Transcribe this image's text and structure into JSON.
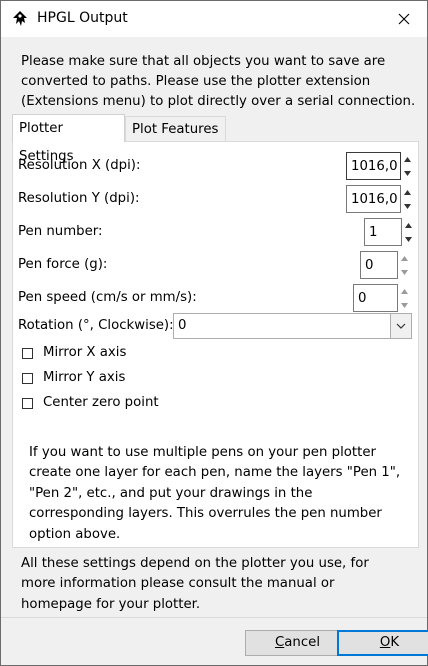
{
  "window": {
    "title": "HPGL Output"
  },
  "intro_text": "Please make sure that all objects you want to save are converted to paths. Please use the plotter extension (Extensions menu) to plot directly over a serial connection.",
  "tabs": [
    {
      "label": "Plotter Settings",
      "active": true
    },
    {
      "label": "Plot Features",
      "active": false
    }
  ],
  "settings": {
    "resolution_x": {
      "label": "Resolution X (dpi):",
      "value": "1016,0"
    },
    "resolution_y": {
      "label": "Resolution Y (dpi):",
      "value": "1016,0"
    },
    "pen_number": {
      "label": "Pen number:",
      "value": "1"
    },
    "pen_force": {
      "label": "Pen force (g):",
      "value": "0"
    },
    "pen_speed": {
      "label": "Pen speed (cm/s or mm/s):",
      "value": "0"
    },
    "rotation": {
      "label": "Rotation (°, Clockwise):",
      "value": "0"
    }
  },
  "checkboxes": {
    "mirror_x": {
      "label": "Mirror X axis",
      "checked": false
    },
    "mirror_y": {
      "label": "Mirror Y axis",
      "checked": false
    },
    "center_zero": {
      "label": "Center zero point",
      "checked": false
    }
  },
  "pen_note": "If you want to use multiple pens on your pen plotter create one layer for each pen, name the layers \"Pen 1\", \"Pen 2\", etc., and put your drawings in the corresponding layers. This overrules the pen number option above.",
  "footer_note": "All these settings depend on the plotter you use, for more information please consult the manual or homepage for your plotter.",
  "buttons": {
    "cancel": {
      "mnemonic": "C",
      "rest": "ancel"
    },
    "ok": {
      "mnemonic": "O",
      "rest": "K"
    }
  }
}
